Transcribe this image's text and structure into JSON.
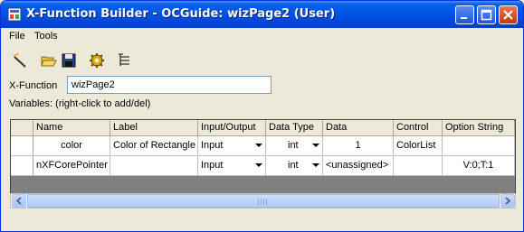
{
  "window": {
    "title": "X-Function Builder - OCGuide: wizPage2 (User)",
    "accent_color": "#0054e3"
  },
  "menu": [
    "File",
    "Tools"
  ],
  "toolbar": {
    "icons": [
      "wand-icon",
      "open-folder-icon",
      "save-icon",
      "gear-icon",
      "tree-view-icon"
    ]
  },
  "xfunction": {
    "label": "X-Function",
    "value": "wizPage2"
  },
  "variables_label": "Variables: (right-click to add/del)",
  "table": {
    "headers": [
      "Name",
      "Label",
      "Input/Output",
      "Data Type",
      "Data",
      "Control",
      "Option String"
    ],
    "rows": [
      {
        "name": "color",
        "label": "Color of Rectangle",
        "io": "Input",
        "type": "int",
        "data": "1",
        "control": "ColorList",
        "option": ""
      },
      {
        "name": "nXFCorePointer",
        "label": "",
        "io": "Input",
        "type": "int",
        "data": "<unassigned>",
        "control": "",
        "option": "V:0;T:1"
      }
    ]
  }
}
